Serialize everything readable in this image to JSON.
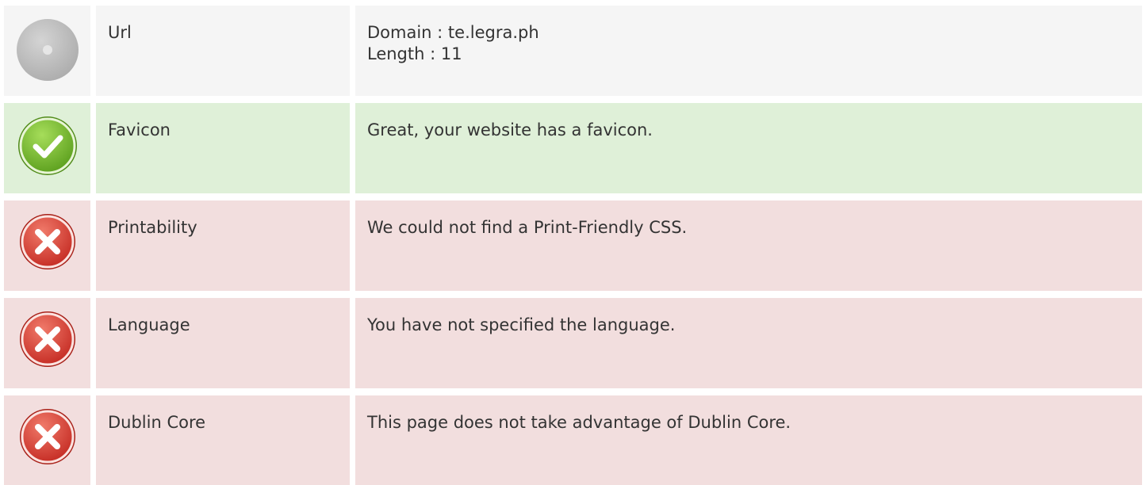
{
  "rows": [
    {
      "status": "neutral",
      "icon": "neutral-circle-icon",
      "label": "Url",
      "lines": [
        "Domain : te.legra.ph",
        "Length : 11"
      ]
    },
    {
      "status": "good",
      "icon": "check-icon",
      "label": "Favicon",
      "lines": [
        "Great, your website has a favicon."
      ]
    },
    {
      "status": "bad",
      "icon": "error-x-icon",
      "label": "Printability",
      "lines": [
        "We could not find a Print-Friendly CSS."
      ]
    },
    {
      "status": "bad",
      "icon": "error-x-icon",
      "label": "Language",
      "lines": [
        "You have not specified the language."
      ]
    },
    {
      "status": "bad",
      "icon": "error-x-icon",
      "label": "Dublin Core",
      "lines": [
        "This page does not take advantage of Dublin Core."
      ]
    }
  ],
  "colors": {
    "neutral_bg": "#f5f5f5",
    "good_bg": "#dff0d8",
    "bad_bg": "#f2dede",
    "check_green": "#7cc242",
    "error_red": "#e04040",
    "neutral_gray": "#bdbdbd"
  }
}
